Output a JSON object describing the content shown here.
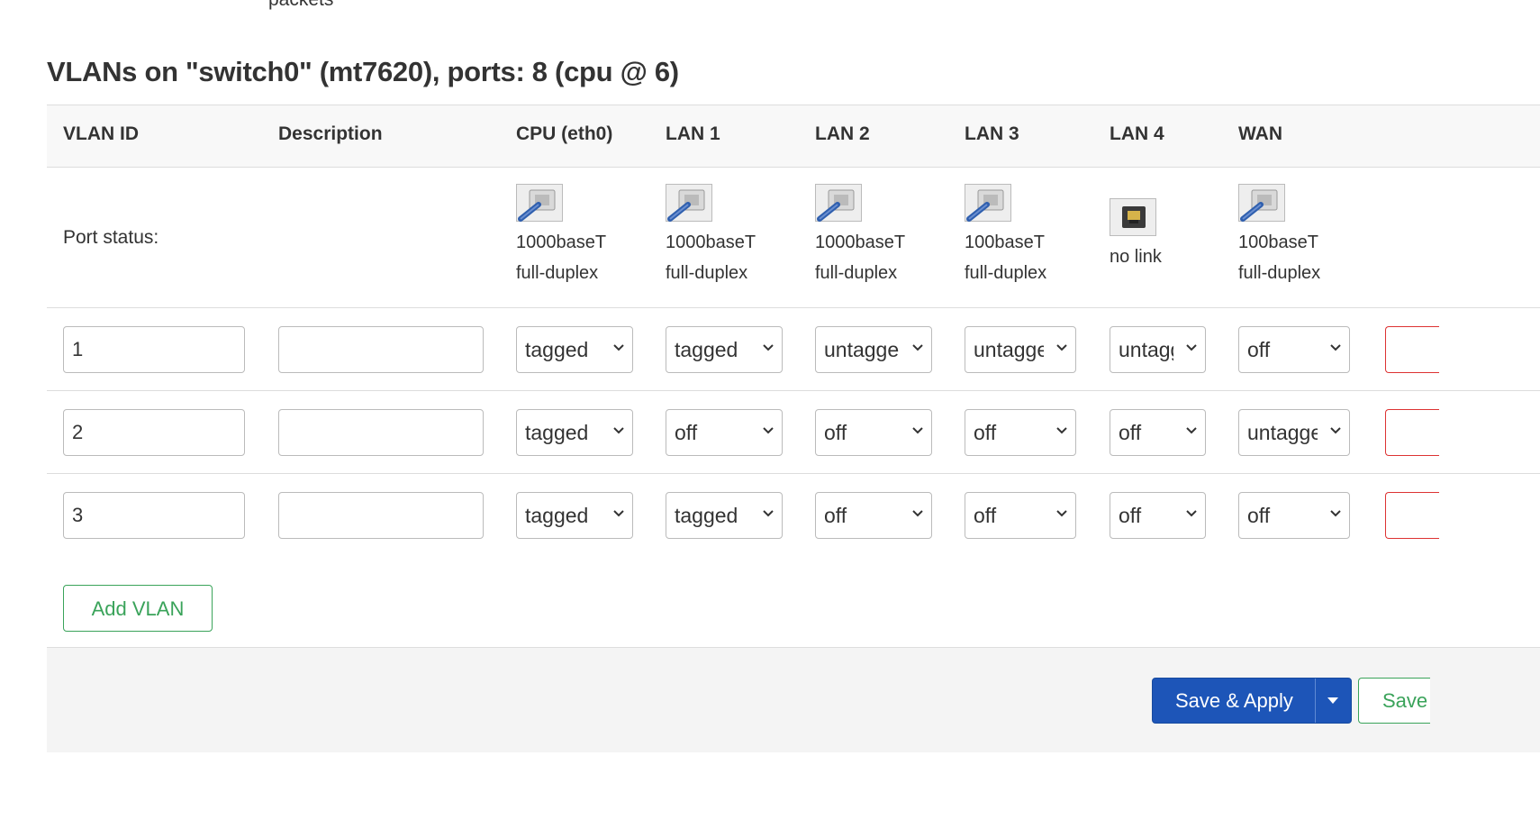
{
  "top_text": "packets",
  "section_title": "VLANs on \"switch0\" (mt7620), ports: 8 (cpu @ 6)",
  "columns": {
    "vlan_id": "VLAN ID",
    "description": "Description",
    "cpu": "CPU (eth0)",
    "lan1": "LAN 1",
    "lan2": "LAN 2",
    "lan3": "LAN 3",
    "lan4": "LAN 4",
    "wan": "WAN"
  },
  "port_status": {
    "label": "Port status:",
    "cpu": {
      "icon": "ethernet-connected-icon",
      "speed": "1000baseT",
      "duplex": "full-duplex"
    },
    "lan1": {
      "icon": "ethernet-connected-icon",
      "speed": "1000baseT",
      "duplex": "full-duplex"
    },
    "lan2": {
      "icon": "ethernet-connected-icon",
      "speed": "1000baseT",
      "duplex": "full-duplex"
    },
    "lan3": {
      "icon": "ethernet-connected-icon",
      "speed": "100baseT",
      "duplex": "full-duplex"
    },
    "lan4": {
      "icon": "ethernet-disconnected-icon",
      "speed": "no link"
    },
    "wan": {
      "icon": "ethernet-connected-icon",
      "speed": "100baseT",
      "duplex": "full-duplex"
    }
  },
  "vlans": [
    {
      "id": "1",
      "description": "",
      "cpu": "tagged",
      "lan1": "tagged",
      "lan2": "untagged",
      "lan3": "untagged",
      "lan4": "untagged",
      "wan": "off"
    },
    {
      "id": "2",
      "description": "",
      "cpu": "tagged",
      "lan1": "off",
      "lan2": "off",
      "lan3": "off",
      "lan4": "off",
      "wan": "untagged"
    },
    {
      "id": "3",
      "description": "",
      "cpu": "tagged",
      "lan1": "tagged",
      "lan2": "off",
      "lan3": "off",
      "lan4": "off",
      "wan": "off"
    }
  ],
  "add_vlan_label": "Add VLAN",
  "footer": {
    "save_apply_label": "Save & Apply",
    "save_label": "Save"
  },
  "colors": {
    "primary": "#1d55b8",
    "positive": "#3aa35a",
    "negative": "#dd3333"
  }
}
